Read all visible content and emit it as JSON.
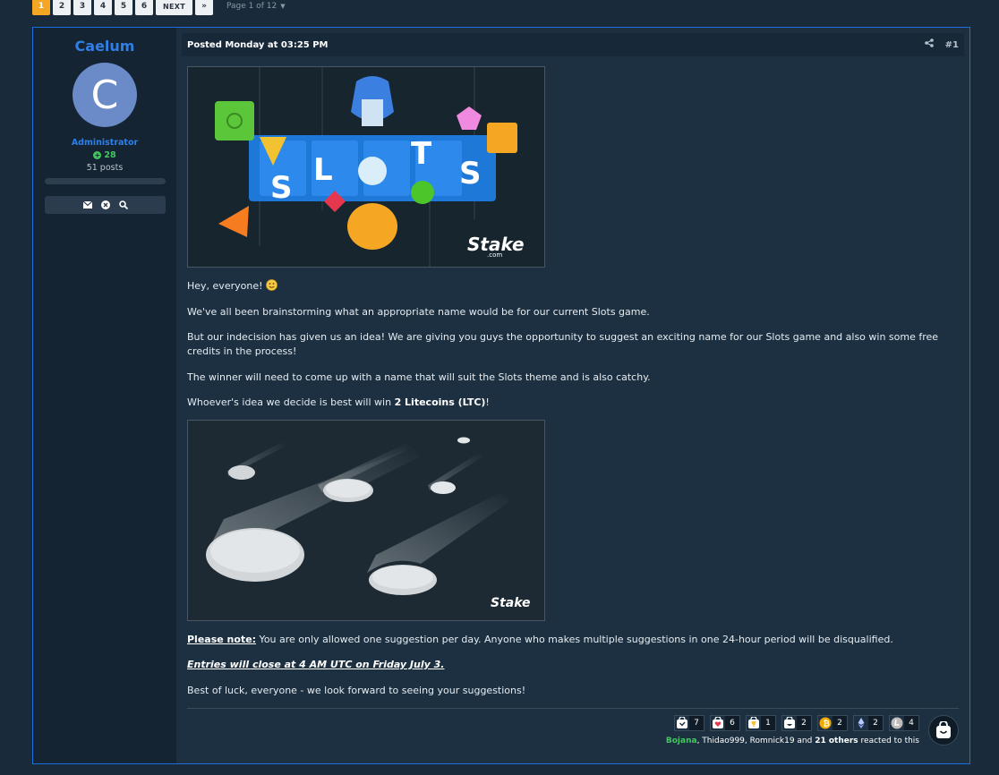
{
  "pagination": {
    "pages": [
      "1",
      "2",
      "3",
      "4",
      "5",
      "6"
    ],
    "active": "1",
    "next_label": "NEXT",
    "last_label": "»",
    "page_of": "Page 1 of 12"
  },
  "author": {
    "name": "Caelum",
    "avatar_letter": "C",
    "role": "Administrator",
    "reputation": "28",
    "posts": "51 posts"
  },
  "post": {
    "posted": "Posted Monday at 03:25 PM",
    "number": "#1",
    "greeting": "Hey, everyone! ",
    "p1": "We've all been brainstorming what an appropriate name would be for our current Slots game.",
    "p2": "But our indecision has given us an idea! We are giving you guys the opportunity to suggest an exciting name for our Slots game and also win some free credits in the process!",
    "p3": "The winner will need to come up with a name that will suit the Slots theme and is also catchy.",
    "p4_pre": "Whoever's idea we decide is best will win ",
    "p4_bold": "2 Litecoins (LTC)",
    "p4_post": "!",
    "note_label": "Please note:",
    "note_text": " You are only allowed one suggestion per day. Anyone who makes multiple suggestions in one 24-hour period will be disqualified.",
    "entries": "Entries will close at 4 AM UTC on Friday July 3.",
    "closing": "Best of luck, everyone - we look forward to seeing your suggestions!",
    "image1": {
      "letters": [
        "S",
        "L",
        "T",
        "S"
      ],
      "brand": "Stake",
      "brand_sub": ".com"
    },
    "image2": {
      "brand": "Stake"
    }
  },
  "reactions": [
    {
      "icon": "like-bag-icon",
      "count": "7"
    },
    {
      "icon": "heart-bag-icon",
      "count": "6"
    },
    {
      "icon": "trophy-bag-icon",
      "count": "1"
    },
    {
      "icon": "laugh-bag-icon",
      "count": "2"
    },
    {
      "icon": "bitcoin-icon",
      "count": "2"
    },
    {
      "icon": "ethereum-icon",
      "count": "2"
    },
    {
      "icon": "litecoin-icon",
      "count": "4"
    }
  ],
  "reacted": {
    "user1": "Bojana",
    "rest": ", Thidao999, Romnick19 and ",
    "others": "21 others",
    "suffix": " reacted to this"
  },
  "colors": {
    "accent": "#1d6fe0",
    "active_page": "#f5a623",
    "green": "#42c95e"
  }
}
